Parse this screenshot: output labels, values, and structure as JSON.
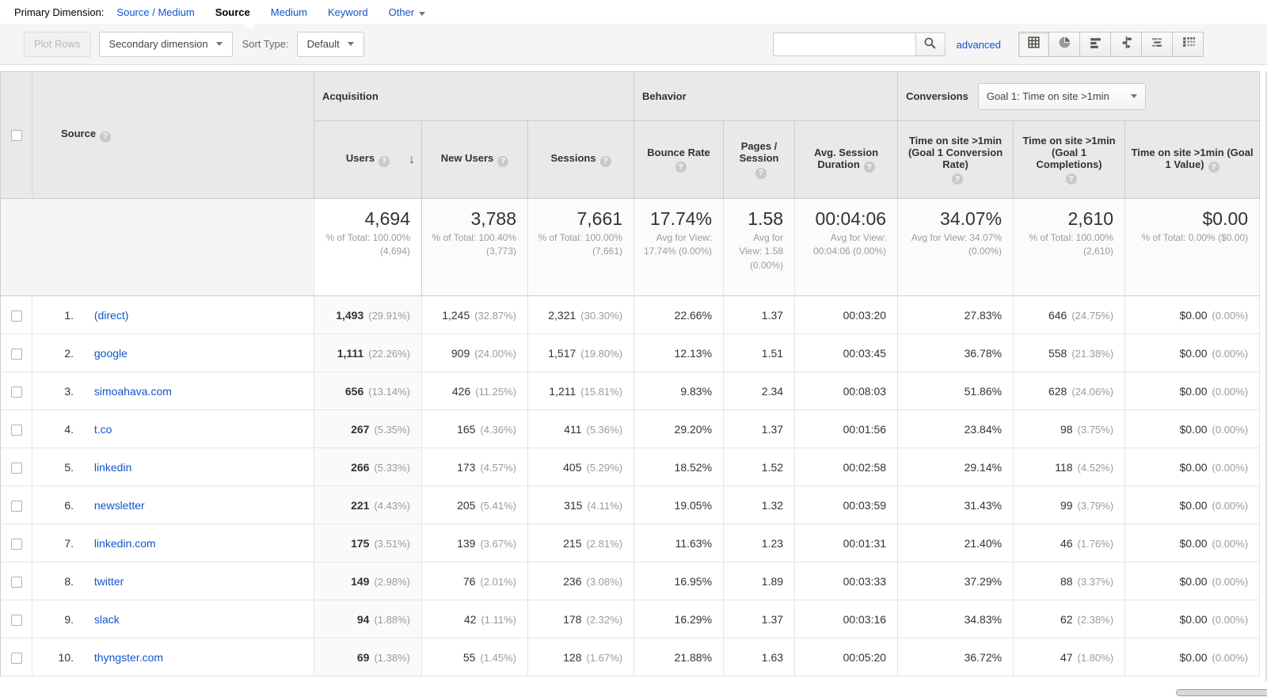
{
  "primary_dimension": {
    "label": "Primary Dimension:",
    "options": [
      {
        "label": "Source / Medium",
        "active": false
      },
      {
        "label": "Source",
        "active": true
      },
      {
        "label": "Medium",
        "active": false
      },
      {
        "label": "Keyword",
        "active": false
      },
      {
        "label": "Other",
        "active": false,
        "has_caret": true
      }
    ]
  },
  "toolbar": {
    "plot_rows_label": "Plot Rows",
    "secondary_dimension_label": "Secondary dimension",
    "sort_type_label": "Sort Type:",
    "sort_type_value": "Default",
    "search_value": "",
    "advanced_label": "advanced",
    "view_buttons": [
      "data-table-view",
      "percentage-view",
      "performance-view",
      "comparison-view",
      "term-cloud-view",
      "pivot-view"
    ],
    "active_view": "data-table-view"
  },
  "colors": {
    "link_blue": "#1155cc",
    "header_bg": "#e9e9e9",
    "toolbar_bg": "#f5f5f5",
    "muted_text": "#9b9b9b"
  },
  "table": {
    "groups": {
      "acquisition": "Acquisition",
      "behavior": "Behavior",
      "conversions": "Conversions",
      "goal_selector": "Goal 1: Time on site >1min"
    },
    "columns": [
      "Source",
      "Users",
      "New Users",
      "Sessions",
      "Bounce Rate",
      "Pages / Session",
      "Avg. Session Duration",
      "Time on site >1min (Goal 1 Conversion Rate)",
      "Time on site >1min (Goal 1 Completions)",
      "Time on site >1min (Goal 1 Value)"
    ],
    "sorted_column": "Users",
    "totals": {
      "users": {
        "value": "4,694",
        "sub": "% of Total: 100.00% (4,694)"
      },
      "new_users": {
        "value": "3,788",
        "sub": "% of Total: 100.40% (3,773)"
      },
      "sessions": {
        "value": "7,661",
        "sub": "% of Total: 100.00% (7,661)"
      },
      "bounce_rate": {
        "value": "17.74%",
        "sub": "Avg for View: 17.74% (0.00%)"
      },
      "pages_session": {
        "value": "1.58",
        "sub": "Avg for View: 1.58 (0.00%)"
      },
      "avg_duration": {
        "value": "00:04:06",
        "sub": "Avg for View: 00:04:06 (0.00%)"
      },
      "conv_rate": {
        "value": "34.07%",
        "sub": "Avg for View: 34.07% (0.00%)"
      },
      "completions": {
        "value": "2,610",
        "sub": "% of Total: 100.00% (2,610)"
      },
      "goal_value": {
        "value": "$0.00",
        "sub": "% of Total: 0.00% ($0.00)"
      }
    },
    "rows": [
      {
        "rank": "1.",
        "source": "(direct)",
        "users": "1,493",
        "users_pct": "(29.91%)",
        "new_users": "1,245",
        "new_users_pct": "(32.87%)",
        "sessions": "2,321",
        "sessions_pct": "(30.30%)",
        "bounce": "22.66%",
        "pages": "1.37",
        "duration": "00:03:20",
        "conv_rate": "27.83%",
        "completions": "646",
        "completions_pct": "(24.75%)",
        "value": "$0.00",
        "value_pct": "(0.00%)"
      },
      {
        "rank": "2.",
        "source": "google",
        "users": "1,111",
        "users_pct": "(22.26%)",
        "new_users": "909",
        "new_users_pct": "(24.00%)",
        "sessions": "1,517",
        "sessions_pct": "(19.80%)",
        "bounce": "12.13%",
        "pages": "1.51",
        "duration": "00:03:45",
        "conv_rate": "36.78%",
        "completions": "558",
        "completions_pct": "(21.38%)",
        "value": "$0.00",
        "value_pct": "(0.00%)"
      },
      {
        "rank": "3.",
        "source": "simoahava.com",
        "users": "656",
        "users_pct": "(13.14%)",
        "new_users": "426",
        "new_users_pct": "(11.25%)",
        "sessions": "1,211",
        "sessions_pct": "(15.81%)",
        "bounce": "9.83%",
        "pages": "2.34",
        "duration": "00:08:03",
        "conv_rate": "51.86%",
        "completions": "628",
        "completions_pct": "(24.06%)",
        "value": "$0.00",
        "value_pct": "(0.00%)"
      },
      {
        "rank": "4.",
        "source": "t.co",
        "users": "267",
        "users_pct": "(5.35%)",
        "new_users": "165",
        "new_users_pct": "(4.36%)",
        "sessions": "411",
        "sessions_pct": "(5.36%)",
        "bounce": "29.20%",
        "pages": "1.37",
        "duration": "00:01:56",
        "conv_rate": "23.84%",
        "completions": "98",
        "completions_pct": "(3.75%)",
        "value": "$0.00",
        "value_pct": "(0.00%)"
      },
      {
        "rank": "5.",
        "source": "linkedin",
        "users": "266",
        "users_pct": "(5.33%)",
        "new_users": "173",
        "new_users_pct": "(4.57%)",
        "sessions": "405",
        "sessions_pct": "(5.29%)",
        "bounce": "18.52%",
        "pages": "1.52",
        "duration": "00:02:58",
        "conv_rate": "29.14%",
        "completions": "118",
        "completions_pct": "(4.52%)",
        "value": "$0.00",
        "value_pct": "(0.00%)"
      },
      {
        "rank": "6.",
        "source": "newsletter",
        "users": "221",
        "users_pct": "(4.43%)",
        "new_users": "205",
        "new_users_pct": "(5.41%)",
        "sessions": "315",
        "sessions_pct": "(4.11%)",
        "bounce": "19.05%",
        "pages": "1.32",
        "duration": "00:03:59",
        "conv_rate": "31.43%",
        "completions": "99",
        "completions_pct": "(3.79%)",
        "value": "$0.00",
        "value_pct": "(0.00%)"
      },
      {
        "rank": "7.",
        "source": "linkedin.com",
        "users": "175",
        "users_pct": "(3.51%)",
        "new_users": "139",
        "new_users_pct": "(3.67%)",
        "sessions": "215",
        "sessions_pct": "(2.81%)",
        "bounce": "11.63%",
        "pages": "1.23",
        "duration": "00:01:31",
        "conv_rate": "21.40%",
        "completions": "46",
        "completions_pct": "(1.76%)",
        "value": "$0.00",
        "value_pct": "(0.00%)"
      },
      {
        "rank": "8.",
        "source": "twitter",
        "users": "149",
        "users_pct": "(2.98%)",
        "new_users": "76",
        "new_users_pct": "(2.01%)",
        "sessions": "236",
        "sessions_pct": "(3.08%)",
        "bounce": "16.95%",
        "pages": "1.89",
        "duration": "00:03:33",
        "conv_rate": "37.29%",
        "completions": "88",
        "completions_pct": "(3.37%)",
        "value": "$0.00",
        "value_pct": "(0.00%)"
      },
      {
        "rank": "9.",
        "source": "slack",
        "users": "94",
        "users_pct": "(1.88%)",
        "new_users": "42",
        "new_users_pct": "(1.11%)",
        "sessions": "178",
        "sessions_pct": "(2.32%)",
        "bounce": "16.29%",
        "pages": "1.37",
        "duration": "00:03:16",
        "conv_rate": "34.83%",
        "completions": "62",
        "completions_pct": "(2.38%)",
        "value": "$0.00",
        "value_pct": "(0.00%)"
      },
      {
        "rank": "10.",
        "source": "thyngster.com",
        "users": "69",
        "users_pct": "(1.38%)",
        "new_users": "55",
        "new_users_pct": "(1.45%)",
        "sessions": "128",
        "sessions_pct": "(1.67%)",
        "bounce": "21.88%",
        "pages": "1.63",
        "duration": "00:05:20",
        "conv_rate": "36.72%",
        "completions": "47",
        "completions_pct": "(1.80%)",
        "value": "$0.00",
        "value_pct": "(0.00%)"
      }
    ]
  }
}
